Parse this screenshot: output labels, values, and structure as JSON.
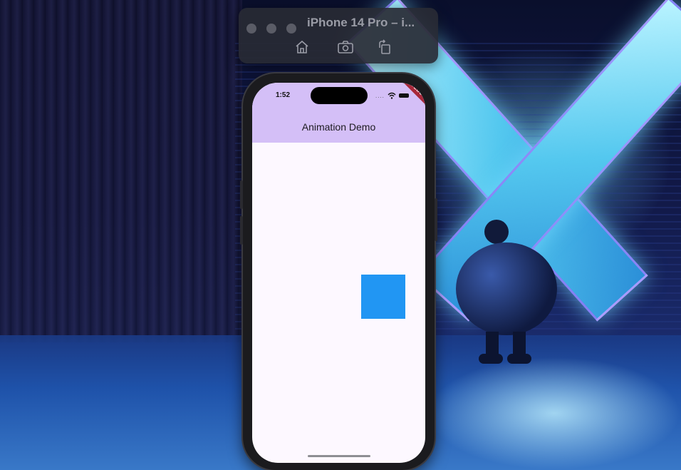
{
  "simulator": {
    "title": "iPhone 14 Pro – i...",
    "buttons": [
      "home-icon",
      "screenshot-icon",
      "rotate-icon"
    ]
  },
  "phone": {
    "status_time": "1:52",
    "signal": "....",
    "debug_label": "DEBUG"
  },
  "app": {
    "title": "Animation Demo",
    "colors": {
      "app_bar": "#d4bff7",
      "background": "#fdf8ff",
      "square": "#2196f3"
    }
  }
}
